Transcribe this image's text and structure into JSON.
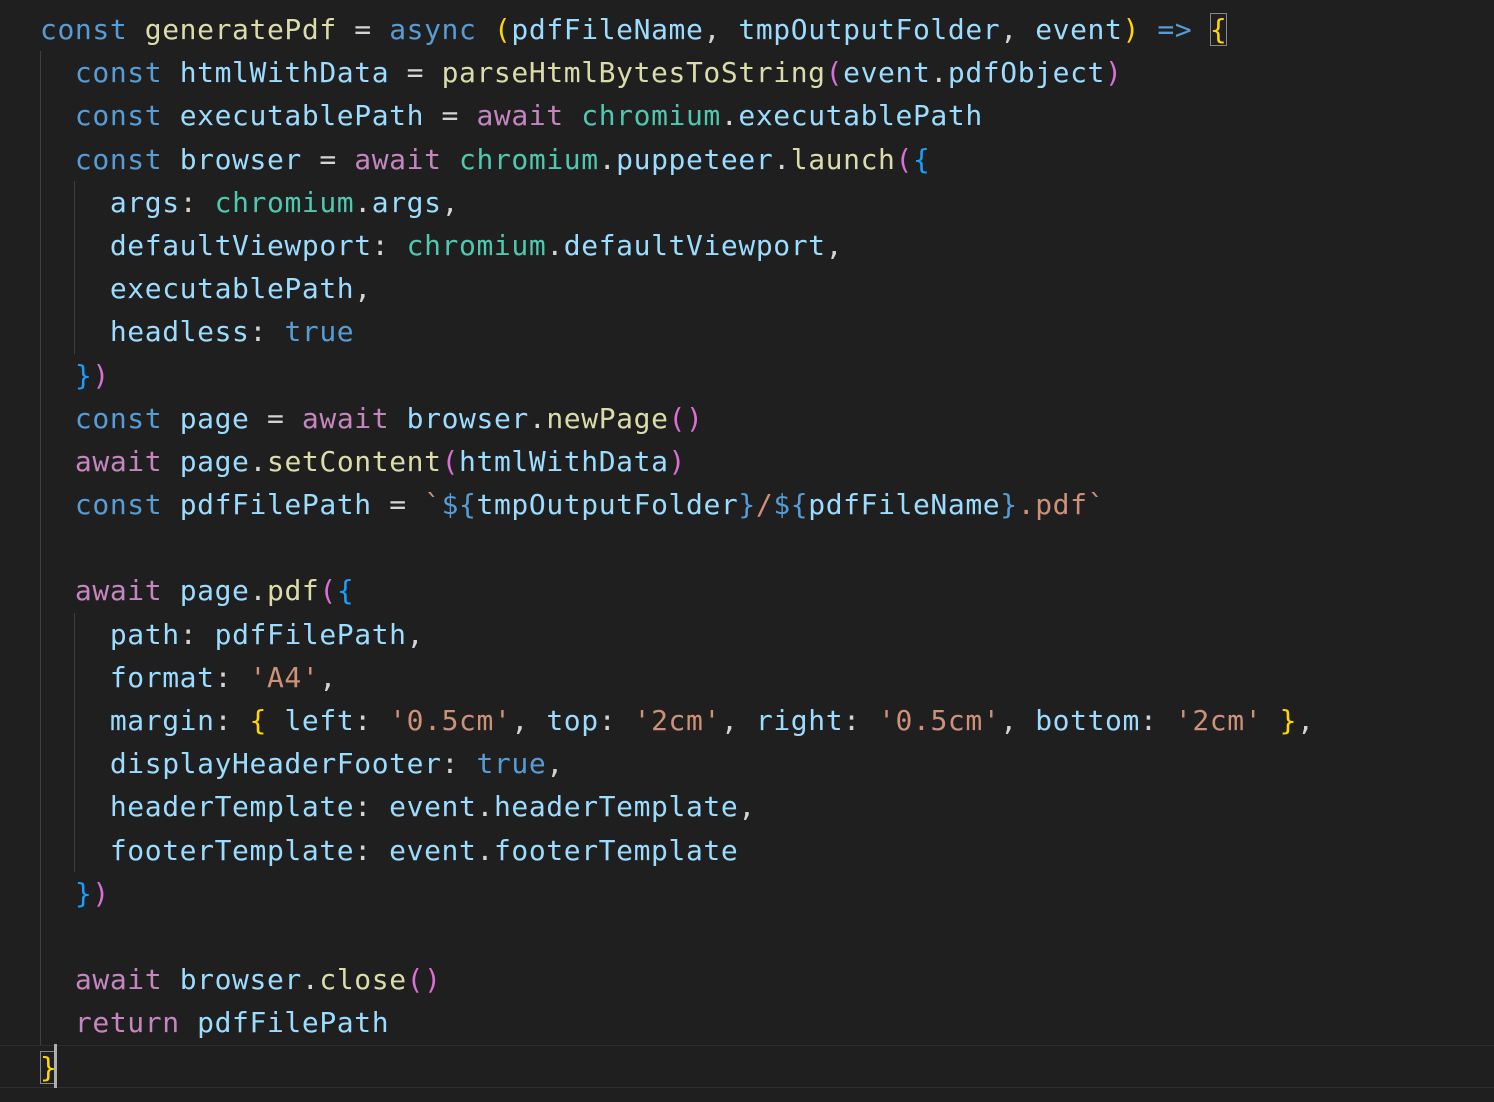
{
  "editor": {
    "theme_colors": {
      "background": "#1f1f1f",
      "keyword_storage": "#569cd6",
      "keyword_control": "#c586c0",
      "function": "#dcdcaa",
      "variable": "#9cdcfe",
      "class": "#4ec9b0",
      "string": "#ce9178",
      "bracket_level1": "#ffd700",
      "bracket_level2": "#da70d6",
      "bracket_level3": "#179fff"
    },
    "lines": [
      {
        "indent": 0,
        "tokens": [
          {
            "t": "const",
            "c": "k-storage"
          },
          {
            "t": " ",
            "c": "punc"
          },
          {
            "t": "generatePdf",
            "c": "fn"
          },
          {
            "t": " = ",
            "c": "op"
          },
          {
            "t": "async",
            "c": "k-storage"
          },
          {
            "t": " ",
            "c": "punc"
          },
          {
            "t": "(",
            "c": "br1"
          },
          {
            "t": "pdfFileName",
            "c": "var"
          },
          {
            "t": ", ",
            "c": "punc"
          },
          {
            "t": "tmpOutputFolder",
            "c": "var"
          },
          {
            "t": ", ",
            "c": "punc"
          },
          {
            "t": "event",
            "c": "var"
          },
          {
            "t": ")",
            "c": "br1"
          },
          {
            "t": " ",
            "c": "punc"
          },
          {
            "t": "=>",
            "c": "k-storage"
          },
          {
            "t": " ",
            "c": "punc"
          },
          {
            "t": "{",
            "c": "br1 bm-box"
          }
        ]
      },
      {
        "indent": 1,
        "tokens": [
          {
            "t": "  ",
            "c": "punc"
          },
          {
            "t": "const",
            "c": "k-storage"
          },
          {
            "t": " ",
            "c": "punc"
          },
          {
            "t": "htmlWithData",
            "c": "var"
          },
          {
            "t": " = ",
            "c": "op"
          },
          {
            "t": "parseHtmlBytesToString",
            "c": "fn"
          },
          {
            "t": "(",
            "c": "br2"
          },
          {
            "t": "event",
            "c": "var"
          },
          {
            "t": ".",
            "c": "punc"
          },
          {
            "t": "pdfObject",
            "c": "prop"
          },
          {
            "t": ")",
            "c": "br2"
          }
        ]
      },
      {
        "indent": 1,
        "tokens": [
          {
            "t": "  ",
            "c": "punc"
          },
          {
            "t": "const",
            "c": "k-storage"
          },
          {
            "t": " ",
            "c": "punc"
          },
          {
            "t": "executablePath",
            "c": "var"
          },
          {
            "t": " = ",
            "c": "op"
          },
          {
            "t": "await",
            "c": "k-control"
          },
          {
            "t": " ",
            "c": "punc"
          },
          {
            "t": "chromium",
            "c": "cls"
          },
          {
            "t": ".",
            "c": "punc"
          },
          {
            "t": "executablePath",
            "c": "prop"
          }
        ]
      },
      {
        "indent": 1,
        "tokens": [
          {
            "t": "  ",
            "c": "punc"
          },
          {
            "t": "const",
            "c": "k-storage"
          },
          {
            "t": " ",
            "c": "punc"
          },
          {
            "t": "browser",
            "c": "var"
          },
          {
            "t": " = ",
            "c": "op"
          },
          {
            "t": "await",
            "c": "k-control"
          },
          {
            "t": " ",
            "c": "punc"
          },
          {
            "t": "chromium",
            "c": "cls"
          },
          {
            "t": ".",
            "c": "punc"
          },
          {
            "t": "puppeteer",
            "c": "prop"
          },
          {
            "t": ".",
            "c": "punc"
          },
          {
            "t": "launch",
            "c": "fn"
          },
          {
            "t": "(",
            "c": "br2"
          },
          {
            "t": "{",
            "c": "br3"
          }
        ]
      },
      {
        "indent": 2,
        "tokens": [
          {
            "t": "    ",
            "c": "punc"
          },
          {
            "t": "args",
            "c": "prop"
          },
          {
            "t": ": ",
            "c": "punc"
          },
          {
            "t": "chromium",
            "c": "cls"
          },
          {
            "t": ".",
            "c": "punc"
          },
          {
            "t": "args",
            "c": "prop"
          },
          {
            "t": ",",
            "c": "punc"
          }
        ]
      },
      {
        "indent": 2,
        "tokens": [
          {
            "t": "    ",
            "c": "punc"
          },
          {
            "t": "defaultViewport",
            "c": "prop"
          },
          {
            "t": ": ",
            "c": "punc"
          },
          {
            "t": "chromium",
            "c": "cls"
          },
          {
            "t": ".",
            "c": "punc"
          },
          {
            "t": "defaultViewport",
            "c": "prop"
          },
          {
            "t": ",",
            "c": "punc"
          }
        ]
      },
      {
        "indent": 2,
        "tokens": [
          {
            "t": "    ",
            "c": "punc"
          },
          {
            "t": "executablePath",
            "c": "prop"
          },
          {
            "t": ",",
            "c": "punc"
          }
        ]
      },
      {
        "indent": 2,
        "tokens": [
          {
            "t": "    ",
            "c": "punc"
          },
          {
            "t": "headless",
            "c": "prop"
          },
          {
            "t": ": ",
            "c": "punc"
          },
          {
            "t": "true",
            "c": "bool"
          }
        ]
      },
      {
        "indent": 1,
        "tokens": [
          {
            "t": "  ",
            "c": "punc"
          },
          {
            "t": "}",
            "c": "br3"
          },
          {
            "t": ")",
            "c": "br2"
          }
        ]
      },
      {
        "indent": 1,
        "tokens": [
          {
            "t": "  ",
            "c": "punc"
          },
          {
            "t": "const",
            "c": "k-storage"
          },
          {
            "t": " ",
            "c": "punc"
          },
          {
            "t": "page",
            "c": "var"
          },
          {
            "t": " = ",
            "c": "op"
          },
          {
            "t": "await",
            "c": "k-control"
          },
          {
            "t": " ",
            "c": "punc"
          },
          {
            "t": "browser",
            "c": "var"
          },
          {
            "t": ".",
            "c": "punc"
          },
          {
            "t": "newPage",
            "c": "fn"
          },
          {
            "t": "()",
            "c": "br2"
          }
        ]
      },
      {
        "indent": 1,
        "tokens": [
          {
            "t": "  ",
            "c": "punc"
          },
          {
            "t": "await",
            "c": "k-control"
          },
          {
            "t": " ",
            "c": "punc"
          },
          {
            "t": "page",
            "c": "var"
          },
          {
            "t": ".",
            "c": "punc"
          },
          {
            "t": "setContent",
            "c": "fn"
          },
          {
            "t": "(",
            "c": "br2"
          },
          {
            "t": "htmlWithData",
            "c": "var"
          },
          {
            "t": ")",
            "c": "br2"
          }
        ]
      },
      {
        "indent": 1,
        "tokens": [
          {
            "t": "  ",
            "c": "punc"
          },
          {
            "t": "const",
            "c": "k-storage"
          },
          {
            "t": " ",
            "c": "punc"
          },
          {
            "t": "pdfFilePath",
            "c": "var"
          },
          {
            "t": " = ",
            "c": "op"
          },
          {
            "t": "`",
            "c": "str"
          },
          {
            "t": "${",
            "c": "tpl"
          },
          {
            "t": "tmpOutputFolder",
            "c": "var"
          },
          {
            "t": "}",
            "c": "tpl"
          },
          {
            "t": "/",
            "c": "str"
          },
          {
            "t": "${",
            "c": "tpl"
          },
          {
            "t": "pdfFileName",
            "c": "var"
          },
          {
            "t": "}",
            "c": "tpl"
          },
          {
            "t": ".pdf`",
            "c": "str"
          }
        ]
      },
      {
        "indent": 1,
        "tokens": []
      },
      {
        "indent": 1,
        "tokens": [
          {
            "t": "  ",
            "c": "punc"
          },
          {
            "t": "await",
            "c": "k-control"
          },
          {
            "t": " ",
            "c": "punc"
          },
          {
            "t": "page",
            "c": "var"
          },
          {
            "t": ".",
            "c": "punc"
          },
          {
            "t": "pdf",
            "c": "fn"
          },
          {
            "t": "(",
            "c": "br2"
          },
          {
            "t": "{",
            "c": "br3"
          }
        ]
      },
      {
        "indent": 2,
        "tokens": [
          {
            "t": "    ",
            "c": "punc"
          },
          {
            "t": "path",
            "c": "prop"
          },
          {
            "t": ": ",
            "c": "punc"
          },
          {
            "t": "pdfFilePath",
            "c": "var"
          },
          {
            "t": ",",
            "c": "punc"
          }
        ]
      },
      {
        "indent": 2,
        "tokens": [
          {
            "t": "    ",
            "c": "punc"
          },
          {
            "t": "format",
            "c": "prop"
          },
          {
            "t": ": ",
            "c": "punc"
          },
          {
            "t": "'A4'",
            "c": "str"
          },
          {
            "t": ",",
            "c": "punc"
          }
        ]
      },
      {
        "indent": 2,
        "tokens": [
          {
            "t": "    ",
            "c": "punc"
          },
          {
            "t": "margin",
            "c": "prop"
          },
          {
            "t": ": ",
            "c": "punc"
          },
          {
            "t": "{",
            "c": "br1"
          },
          {
            "t": " ",
            "c": "punc"
          },
          {
            "t": "left",
            "c": "prop"
          },
          {
            "t": ": ",
            "c": "punc"
          },
          {
            "t": "'0.5cm'",
            "c": "str"
          },
          {
            "t": ", ",
            "c": "punc"
          },
          {
            "t": "top",
            "c": "prop"
          },
          {
            "t": ": ",
            "c": "punc"
          },
          {
            "t": "'2cm'",
            "c": "str"
          },
          {
            "t": ", ",
            "c": "punc"
          },
          {
            "t": "right",
            "c": "prop"
          },
          {
            "t": ": ",
            "c": "punc"
          },
          {
            "t": "'0.5cm'",
            "c": "str"
          },
          {
            "t": ", ",
            "c": "punc"
          },
          {
            "t": "bottom",
            "c": "prop"
          },
          {
            "t": ": ",
            "c": "punc"
          },
          {
            "t": "'2cm'",
            "c": "str"
          },
          {
            "t": " ",
            "c": "punc"
          },
          {
            "t": "}",
            "c": "br1"
          },
          {
            "t": ",",
            "c": "punc"
          }
        ]
      },
      {
        "indent": 2,
        "tokens": [
          {
            "t": "    ",
            "c": "punc"
          },
          {
            "t": "displayHeaderFooter",
            "c": "prop"
          },
          {
            "t": ": ",
            "c": "punc"
          },
          {
            "t": "true",
            "c": "bool"
          },
          {
            "t": ",",
            "c": "punc"
          }
        ]
      },
      {
        "indent": 2,
        "tokens": [
          {
            "t": "    ",
            "c": "punc"
          },
          {
            "t": "headerTemplate",
            "c": "prop"
          },
          {
            "t": ": ",
            "c": "punc"
          },
          {
            "t": "event",
            "c": "var"
          },
          {
            "t": ".",
            "c": "punc"
          },
          {
            "t": "headerTemplate",
            "c": "prop"
          },
          {
            "t": ",",
            "c": "punc"
          }
        ]
      },
      {
        "indent": 2,
        "tokens": [
          {
            "t": "    ",
            "c": "punc"
          },
          {
            "t": "footerTemplate",
            "c": "prop"
          },
          {
            "t": ": ",
            "c": "punc"
          },
          {
            "t": "event",
            "c": "var"
          },
          {
            "t": ".",
            "c": "punc"
          },
          {
            "t": "footerTemplate",
            "c": "prop"
          }
        ]
      },
      {
        "indent": 1,
        "tokens": [
          {
            "t": "  ",
            "c": "punc"
          },
          {
            "t": "}",
            "c": "br3"
          },
          {
            "t": ")",
            "c": "br2"
          }
        ]
      },
      {
        "indent": 1,
        "tokens": []
      },
      {
        "indent": 1,
        "tokens": [
          {
            "t": "  ",
            "c": "punc"
          },
          {
            "t": "await",
            "c": "k-control"
          },
          {
            "t": " ",
            "c": "punc"
          },
          {
            "t": "browser",
            "c": "var"
          },
          {
            "t": ".",
            "c": "punc"
          },
          {
            "t": "close",
            "c": "fn"
          },
          {
            "t": "()",
            "c": "br2"
          }
        ]
      },
      {
        "indent": 1,
        "tokens": [
          {
            "t": "  ",
            "c": "punc"
          },
          {
            "t": "return",
            "c": "k-control"
          },
          {
            "t": " ",
            "c": "punc"
          },
          {
            "t": "pdfFilePath",
            "c": "var"
          }
        ]
      },
      {
        "indent": 0,
        "current": true,
        "tokens": [
          {
            "t": "}",
            "c": "br1 bm-box"
          }
        ]
      }
    ]
  }
}
